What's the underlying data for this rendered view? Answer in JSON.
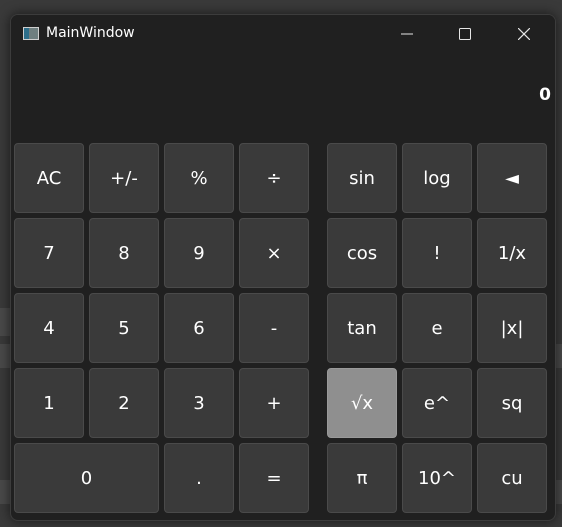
{
  "window": {
    "title": "MainWindow",
    "controls": [
      "minimize-icon",
      "maximize-icon",
      "close-icon"
    ]
  },
  "display": {
    "value": "0"
  },
  "keypad": {
    "left": [
      [
        "AC",
        "+/-",
        "%",
        "÷"
      ],
      [
        "7",
        "8",
        "9",
        "×"
      ],
      [
        "4",
        "5",
        "6",
        "-"
      ],
      [
        "1",
        "2",
        "3",
        "+"
      ],
      [
        "0",
        ".",
        "="
      ]
    ],
    "right": [
      [
        "sin",
        "log",
        "◄"
      ],
      [
        "cos",
        "!",
        "1/x"
      ],
      [
        "tan",
        "e",
        "|x|"
      ],
      [
        "√x",
        "e^",
        "sq"
      ],
      [
        "π",
        "10^",
        "cu"
      ]
    ]
  },
  "colors": {
    "window_bg": "#202020",
    "button_bg": "#3a3a3a",
    "button_active_bg": "#8f8f8f",
    "text": "#ffffff"
  },
  "state": {
    "highlighted_key": "√x"
  }
}
